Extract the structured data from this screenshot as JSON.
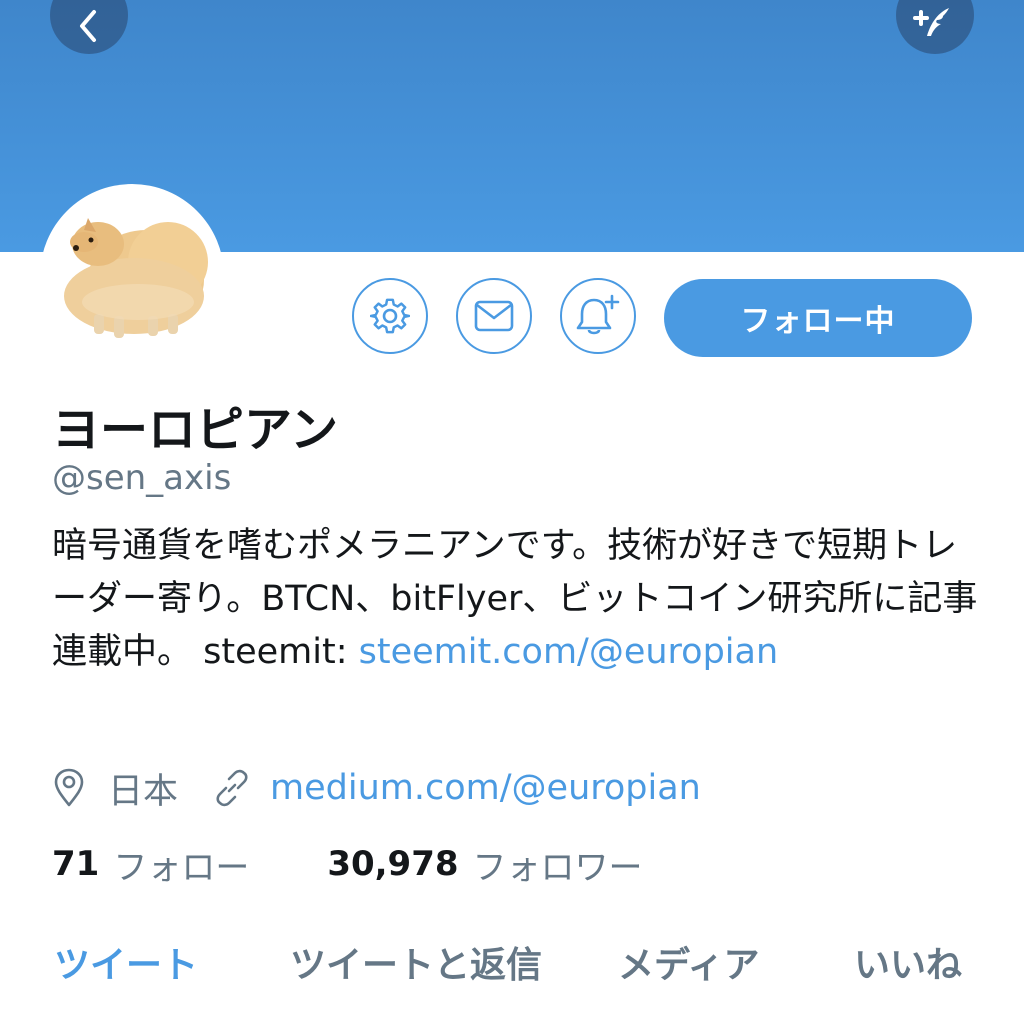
{
  "profile": {
    "display_name": "ヨーロピアン",
    "handle": "@sen_axis",
    "bio_text": "暗号通貨を嗜むポメラニアンです。技術が好きで短期トレーダー寄り。BTCN、bitFlyer、ビットコイン研究所に記事連載中。 steemit: ",
    "bio_link": "steemit.com/@europian",
    "location": "日本",
    "website": "medium.com/@europian"
  },
  "actions": {
    "follow_label": "フォロー中"
  },
  "stats": {
    "following_count": "71",
    "following_label": "フォロー",
    "followers_count": "30,978",
    "followers_label": "フォロワー"
  },
  "tabs": [
    {
      "label": "ツイート",
      "active": true
    },
    {
      "label": "ツイートと返信",
      "active": false
    },
    {
      "label": "メディア",
      "active": false
    },
    {
      "label": "いいね",
      "active": false
    }
  ],
  "icons": [
    "back-icon",
    "compose-icon",
    "gear-icon",
    "mail-icon",
    "bell-plus-icon",
    "location-pin-icon",
    "link-icon"
  ],
  "colors": {
    "accent": "#4a9ae2",
    "banner": "#3f86cb",
    "secondary_text": "#657786"
  }
}
